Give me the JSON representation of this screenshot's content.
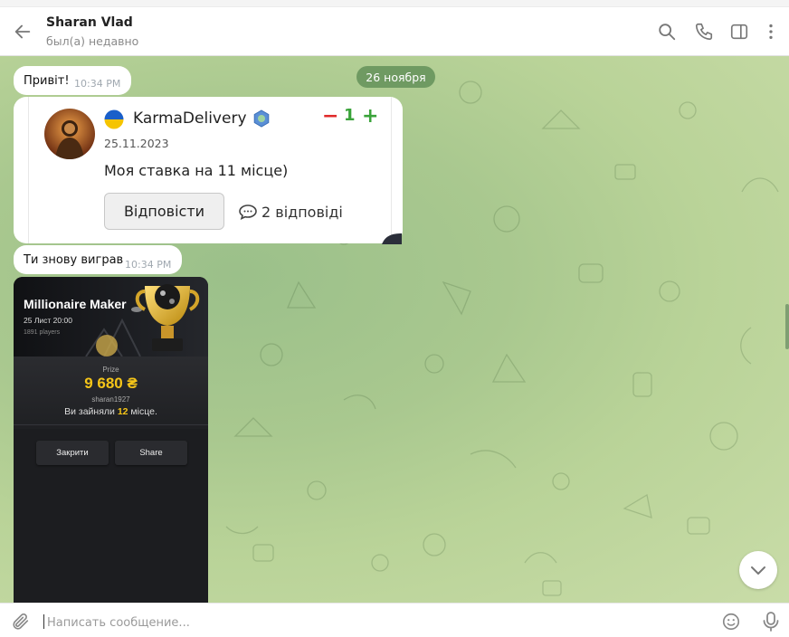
{
  "header": {
    "title": "Sharan Vlad",
    "status": "был(а) недавно"
  },
  "chat": {
    "date_pill": "26 ноября",
    "messages": [
      {
        "text": "Привіт!",
        "time": "10:34 PM"
      },
      {
        "text": "Ти знову виграв",
        "time": "10:34 PM"
      }
    ],
    "forward_card": {
      "owner": "KarmaDelivery",
      "karma_minus": "−",
      "karma_value": "1",
      "karma_plus": "+",
      "date": "25.11.2023",
      "text": "Моя ставка на 11 місце)",
      "reply_label": "Відповісти",
      "replies_label": "2 відповіді"
    },
    "game_card": {
      "title": "Millionaire Maker",
      "date": "25 Лист 20:00",
      "players": "1891 players",
      "prize_label": "Prize",
      "prize_amount": "9 680 ₴",
      "username": "sharan1927",
      "place_prefix": "Ви зайняли",
      "place_value": "12",
      "place_suffix": "місце.",
      "close_label": "Закрити",
      "share_label": "Share"
    }
  },
  "composer": {
    "placeholder": "Написать сообщение..."
  },
  "colors": {
    "accent_green": "#3aa33a",
    "accent_red": "#e02a2a",
    "prize_gold": "#f5c518",
    "date_pill": "#6f9a62"
  }
}
